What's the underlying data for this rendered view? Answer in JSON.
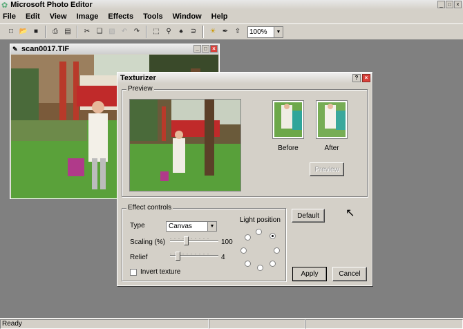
{
  "app": {
    "title": "Microsoft Photo Editor"
  },
  "menu": [
    "File",
    "Edit",
    "View",
    "Image",
    "Effects",
    "Tools",
    "Window",
    "Help"
  ],
  "toolbar": {
    "zoom": "100%"
  },
  "document": {
    "title": "scan0017.TIF"
  },
  "dialog": {
    "title": "Texturizer",
    "preview_label": "Preview",
    "before_label": "Before",
    "after_label": "After",
    "preview_button": "Preview",
    "effect_controls_label": "Effect controls",
    "type_label": "Type",
    "type_value": "Canvas",
    "scaling_label": "Scaling (%)",
    "scaling_value": "100",
    "relief_label": "Relief",
    "relief_value": "4",
    "light_position_label": "Light position",
    "invert_label": "Invert texture",
    "default_button": "Default",
    "apply_button": "Apply",
    "cancel_button": "Cancel"
  },
  "status": {
    "text": "Ready"
  }
}
